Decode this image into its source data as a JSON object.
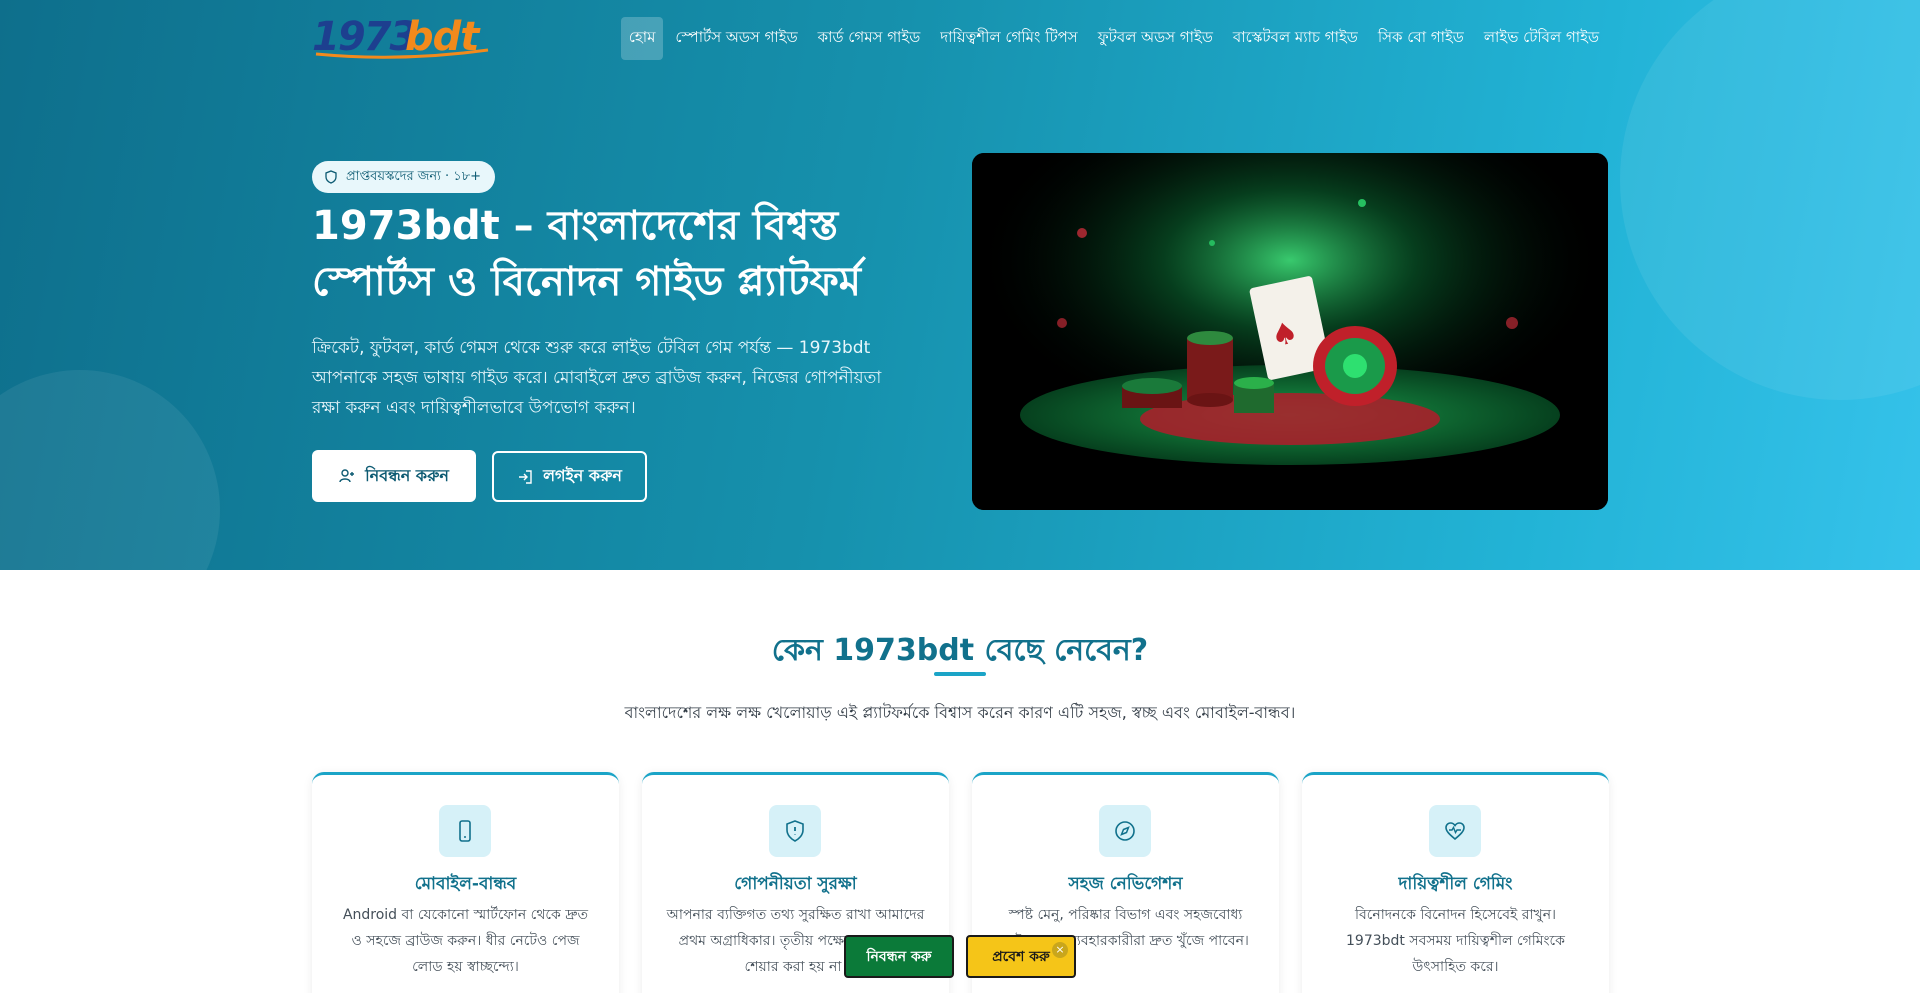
{
  "header": {
    "logo": "1973bdt",
    "nav": [
      {
        "label": "হোম",
        "active": true
      },
      {
        "label": "স্পোর্টস অডস গাইড",
        "active": false
      },
      {
        "label": "কার্ড গেমস গাইড",
        "active": false
      },
      {
        "label": "দায়িত্বশীল গেমিং টিপস",
        "active": false
      },
      {
        "label": "ফুটবল অডস গাইড",
        "active": false
      },
      {
        "label": "বাস্কেটবল ম্যাচ গাইড",
        "active": false
      },
      {
        "label": "সিক বো গাইড",
        "active": false
      },
      {
        "label": "লাইভ টেবিল গাইড",
        "active": false
      }
    ]
  },
  "hero": {
    "badge": "প্রাপ্তবয়স্কদের জন্য · ১৮+",
    "title": "1973bdt – বাংলাদেশের বিশ্বস্ত স্পোর্টস ও বিনোদন গাইড প্ল্যাটফর্ম",
    "description": "ক্রিকেট, ফুটবল, কার্ড গেমস থেকে শুরু করে লাইভ টেবিল গেম পর্যন্ত — 1973bdt আপনাকে সহজ ভাষায় গাইড করে। মোবাইলে দ্রুত ব্রাউজ করুন, নিজের গোপনীয়তা রক্ষা করুন এবং দায়িত্বশীলভাবে উপভোগ করুন।",
    "register_label": "নিবন্ধন করুন",
    "login_label": "লগইন করুন"
  },
  "why": {
    "title": "কেন 1973bdt বেছে নেবেন?",
    "subtitle": "বাংলাদেশের লক্ষ লক্ষ খেলোয়াড় এই প্ল্যাটফর্মকে বিশ্বাস করেন কারণ এটি সহজ, স্বচ্ছ এবং মোবাইল-বান্ধব।",
    "cards": [
      {
        "icon": "mobile-icon",
        "title": "মোবাইল-বান্ধব",
        "text": "Android বা যেকোনো স্মার্টফোন থেকে দ্রুত ও সহজে ব্রাউজ করুন। ধীর নেটেও পেজ লোড হয় স্বাচ্ছন্দ্যে।"
      },
      {
        "icon": "shield-icon",
        "title": "গোপনীয়তা সুরক্ষা",
        "text": "আপনার ব্যক্তিগত তথ্য সুরক্ষিত রাখা আমাদের প্রথম অগ্রাধিকার। তৃতীয় পক্ষের সাথে তথ্য শেয়ার করা হয় না।"
      },
      {
        "icon": "compass-icon",
        "title": "সহজ নেভিগেশন",
        "text": "স্পষ্ট মেনু, পরিষ্কার বিভাগ এবং সহজবোধ্য গাইড নতুন ব্যবহারকারীরা দ্রুত খুঁজে পাবেন।"
      },
      {
        "icon": "heart-pulse-icon",
        "title": "দায়িত্বশীল গেমিং",
        "text": "বিনোদনকে বিনোদন হিসেবেই রাখুন। 1973bdt সবসময় দায়িত্বশীল গেমিংকে উৎসাহিত করে।"
      }
    ]
  },
  "sticky": {
    "register_label": "নিবন্ধন করু",
    "enter_label": "প্রবেশ করু",
    "close_symbol": "×"
  },
  "colors": {
    "hero_gradient_start": "#0e6f8c",
    "hero_gradient_end": "#35c2ea",
    "accent": "#11718c",
    "sticky_green": "#0b7a39",
    "sticky_yellow": "#f5c518",
    "logo_blue": "#1d3f8f",
    "logo_orange": "#f28a1c"
  }
}
